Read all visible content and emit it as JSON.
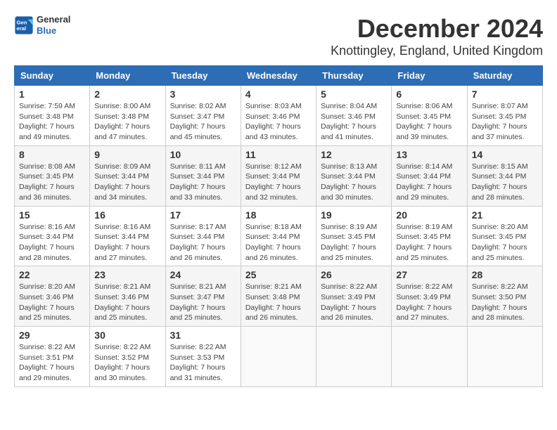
{
  "header": {
    "logo_line1": "General",
    "logo_line2": "Blue",
    "month_title": "December 2024",
    "location": "Knottingley, England, United Kingdom"
  },
  "days_of_week": [
    "Sunday",
    "Monday",
    "Tuesday",
    "Wednesday",
    "Thursday",
    "Friday",
    "Saturday"
  ],
  "weeks": [
    [
      {
        "day": "1",
        "sunrise": "Sunrise: 7:59 AM",
        "sunset": "Sunset: 3:48 PM",
        "daylight": "Daylight: 7 hours and 49 minutes."
      },
      {
        "day": "2",
        "sunrise": "Sunrise: 8:00 AM",
        "sunset": "Sunset: 3:48 PM",
        "daylight": "Daylight: 7 hours and 47 minutes."
      },
      {
        "day": "3",
        "sunrise": "Sunrise: 8:02 AM",
        "sunset": "Sunset: 3:47 PM",
        "daylight": "Daylight: 7 hours and 45 minutes."
      },
      {
        "day": "4",
        "sunrise": "Sunrise: 8:03 AM",
        "sunset": "Sunset: 3:46 PM",
        "daylight": "Daylight: 7 hours and 43 minutes."
      },
      {
        "day": "5",
        "sunrise": "Sunrise: 8:04 AM",
        "sunset": "Sunset: 3:46 PM",
        "daylight": "Daylight: 7 hours and 41 minutes."
      },
      {
        "day": "6",
        "sunrise": "Sunrise: 8:06 AM",
        "sunset": "Sunset: 3:45 PM",
        "daylight": "Daylight: 7 hours and 39 minutes."
      },
      {
        "day": "7",
        "sunrise": "Sunrise: 8:07 AM",
        "sunset": "Sunset: 3:45 PM",
        "daylight": "Daylight: 7 hours and 37 minutes."
      }
    ],
    [
      {
        "day": "8",
        "sunrise": "Sunrise: 8:08 AM",
        "sunset": "Sunset: 3:45 PM",
        "daylight": "Daylight: 7 hours and 36 minutes."
      },
      {
        "day": "9",
        "sunrise": "Sunrise: 8:09 AM",
        "sunset": "Sunset: 3:44 PM",
        "daylight": "Daylight: 7 hours and 34 minutes."
      },
      {
        "day": "10",
        "sunrise": "Sunrise: 8:11 AM",
        "sunset": "Sunset: 3:44 PM",
        "daylight": "Daylight: 7 hours and 33 minutes."
      },
      {
        "day": "11",
        "sunrise": "Sunrise: 8:12 AM",
        "sunset": "Sunset: 3:44 PM",
        "daylight": "Daylight: 7 hours and 32 minutes."
      },
      {
        "day": "12",
        "sunrise": "Sunrise: 8:13 AM",
        "sunset": "Sunset: 3:44 PM",
        "daylight": "Daylight: 7 hours and 30 minutes."
      },
      {
        "day": "13",
        "sunrise": "Sunrise: 8:14 AM",
        "sunset": "Sunset: 3:44 PM",
        "daylight": "Daylight: 7 hours and 29 minutes."
      },
      {
        "day": "14",
        "sunrise": "Sunrise: 8:15 AM",
        "sunset": "Sunset: 3:44 PM",
        "daylight": "Daylight: 7 hours and 28 minutes."
      }
    ],
    [
      {
        "day": "15",
        "sunrise": "Sunrise: 8:16 AM",
        "sunset": "Sunset: 3:44 PM",
        "daylight": "Daylight: 7 hours and 28 minutes."
      },
      {
        "day": "16",
        "sunrise": "Sunrise: 8:16 AM",
        "sunset": "Sunset: 3:44 PM",
        "daylight": "Daylight: 7 hours and 27 minutes."
      },
      {
        "day": "17",
        "sunrise": "Sunrise: 8:17 AM",
        "sunset": "Sunset: 3:44 PM",
        "daylight": "Daylight: 7 hours and 26 minutes."
      },
      {
        "day": "18",
        "sunrise": "Sunrise: 8:18 AM",
        "sunset": "Sunset: 3:44 PM",
        "daylight": "Daylight: 7 hours and 26 minutes."
      },
      {
        "day": "19",
        "sunrise": "Sunrise: 8:19 AM",
        "sunset": "Sunset: 3:45 PM",
        "daylight": "Daylight: 7 hours and 25 minutes."
      },
      {
        "day": "20",
        "sunrise": "Sunrise: 8:19 AM",
        "sunset": "Sunset: 3:45 PM",
        "daylight": "Daylight: 7 hours and 25 minutes."
      },
      {
        "day": "21",
        "sunrise": "Sunrise: 8:20 AM",
        "sunset": "Sunset: 3:45 PM",
        "daylight": "Daylight: 7 hours and 25 minutes."
      }
    ],
    [
      {
        "day": "22",
        "sunrise": "Sunrise: 8:20 AM",
        "sunset": "Sunset: 3:46 PM",
        "daylight": "Daylight: 7 hours and 25 minutes."
      },
      {
        "day": "23",
        "sunrise": "Sunrise: 8:21 AM",
        "sunset": "Sunset: 3:46 PM",
        "daylight": "Daylight: 7 hours and 25 minutes."
      },
      {
        "day": "24",
        "sunrise": "Sunrise: 8:21 AM",
        "sunset": "Sunset: 3:47 PM",
        "daylight": "Daylight: 7 hours and 25 minutes."
      },
      {
        "day": "25",
        "sunrise": "Sunrise: 8:21 AM",
        "sunset": "Sunset: 3:48 PM",
        "daylight": "Daylight: 7 hours and 26 minutes."
      },
      {
        "day": "26",
        "sunrise": "Sunrise: 8:22 AM",
        "sunset": "Sunset: 3:49 PM",
        "daylight": "Daylight: 7 hours and 26 minutes."
      },
      {
        "day": "27",
        "sunrise": "Sunrise: 8:22 AM",
        "sunset": "Sunset: 3:49 PM",
        "daylight": "Daylight: 7 hours and 27 minutes."
      },
      {
        "day": "28",
        "sunrise": "Sunrise: 8:22 AM",
        "sunset": "Sunset: 3:50 PM",
        "daylight": "Daylight: 7 hours and 28 minutes."
      }
    ],
    [
      {
        "day": "29",
        "sunrise": "Sunrise: 8:22 AM",
        "sunset": "Sunset: 3:51 PM",
        "daylight": "Daylight: 7 hours and 29 minutes."
      },
      {
        "day": "30",
        "sunrise": "Sunrise: 8:22 AM",
        "sunset": "Sunset: 3:52 PM",
        "daylight": "Daylight: 7 hours and 30 minutes."
      },
      {
        "day": "31",
        "sunrise": "Sunrise: 8:22 AM",
        "sunset": "Sunset: 3:53 PM",
        "daylight": "Daylight: 7 hours and 31 minutes."
      },
      null,
      null,
      null,
      null
    ]
  ]
}
